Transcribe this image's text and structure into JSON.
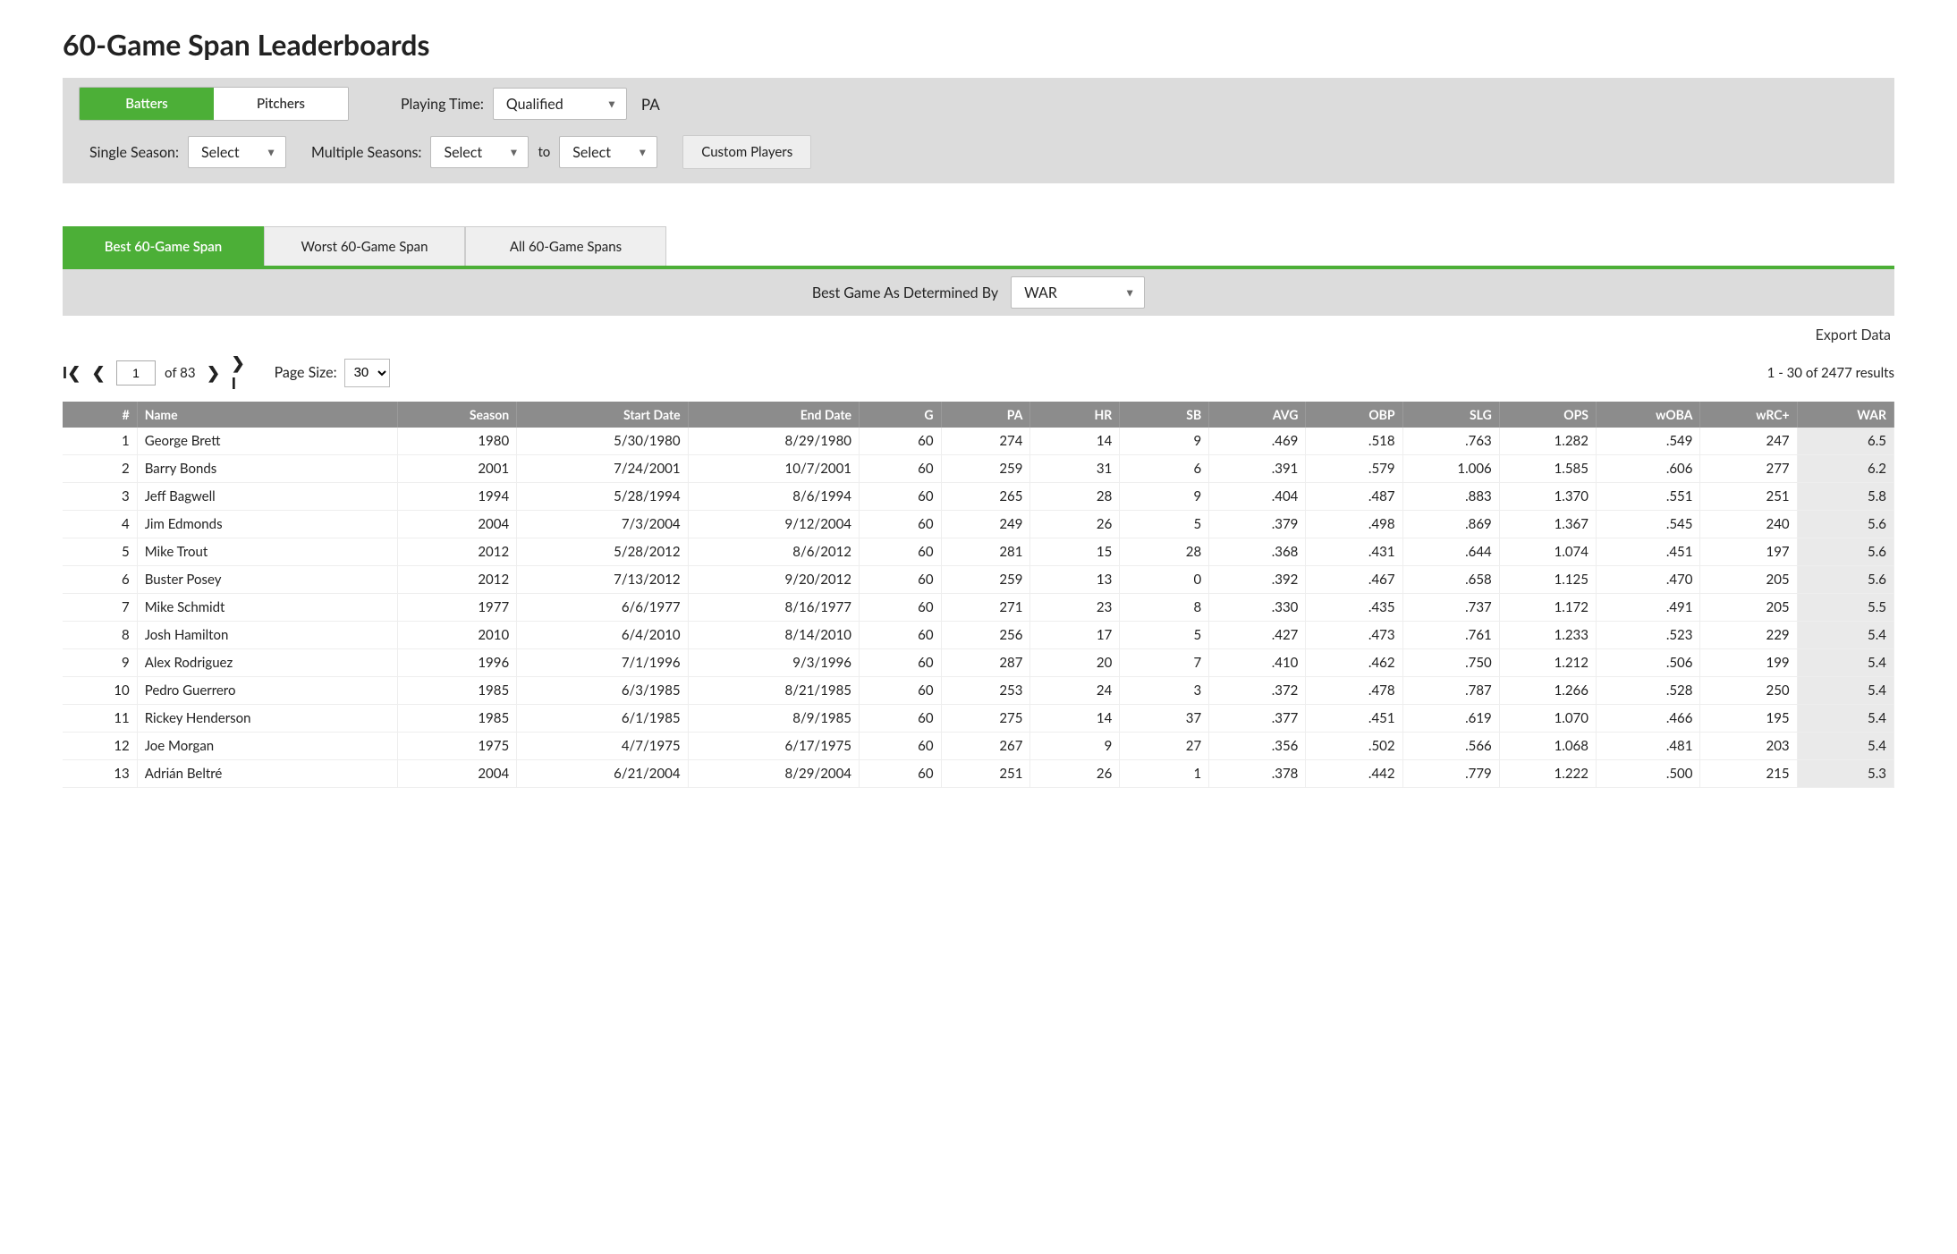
{
  "page_title": "60-Game Span Leaderboards",
  "top_toggle": {
    "batters": "Batters",
    "pitchers": "Pitchers",
    "active": "batters"
  },
  "playing_time": {
    "label": "Playing Time:",
    "value": "Qualified",
    "unit": "PA"
  },
  "single_season": {
    "label": "Single Season:",
    "value": "Select"
  },
  "multi_season": {
    "label": "Multiple Seasons:",
    "from": "Select",
    "to_word": "to",
    "to": "Select"
  },
  "custom_players_btn": "Custom Players",
  "span_tabs": {
    "best": "Best 60-Game Span",
    "worst": "Worst 60-Game Span",
    "all": "All 60-Game Spans",
    "active": "best"
  },
  "determined_by": {
    "label": "Best Game As Determined By",
    "value": "WAR"
  },
  "export_label": "Export Data",
  "pager": {
    "page_value": "1",
    "of_pages": "of 83",
    "page_size_label": "Page Size:",
    "page_size_value": "30",
    "results_text": "1 - 30 of 2477 results"
  },
  "columns": [
    "#",
    "Name",
    "Season",
    "Start Date",
    "End Date",
    "G",
    "PA",
    "HR",
    "SB",
    "AVG",
    "OBP",
    "SLG",
    "OPS",
    "wOBA",
    "wRC+",
    "WAR"
  ],
  "rows": [
    {
      "n": 1,
      "name": "George Brett",
      "season": 1980,
      "start": "5/30/1980",
      "end": "8/29/1980",
      "g": 60,
      "pa": 274,
      "hr": 14,
      "sb": 9,
      "avg": ".469",
      "obp": ".518",
      "slg": ".763",
      "ops": "1.282",
      "woba": ".549",
      "wrc": 247,
      "war": "6.5"
    },
    {
      "n": 2,
      "name": "Barry Bonds",
      "season": 2001,
      "start": "7/24/2001",
      "end": "10/7/2001",
      "g": 60,
      "pa": 259,
      "hr": 31,
      "sb": 6,
      "avg": ".391",
      "obp": ".579",
      "slg": "1.006",
      "ops": "1.585",
      "woba": ".606",
      "wrc": 277,
      "war": "6.2"
    },
    {
      "n": 3,
      "name": "Jeff Bagwell",
      "season": 1994,
      "start": "5/28/1994",
      "end": "8/6/1994",
      "g": 60,
      "pa": 265,
      "hr": 28,
      "sb": 9,
      "avg": ".404",
      "obp": ".487",
      "slg": ".883",
      "ops": "1.370",
      "woba": ".551",
      "wrc": 251,
      "war": "5.8"
    },
    {
      "n": 4,
      "name": "Jim Edmonds",
      "season": 2004,
      "start": "7/3/2004",
      "end": "9/12/2004",
      "g": 60,
      "pa": 249,
      "hr": 26,
      "sb": 5,
      "avg": ".379",
      "obp": ".498",
      "slg": ".869",
      "ops": "1.367",
      "woba": ".545",
      "wrc": 240,
      "war": "5.6"
    },
    {
      "n": 5,
      "name": "Mike Trout",
      "season": 2012,
      "start": "5/28/2012",
      "end": "8/6/2012",
      "g": 60,
      "pa": 281,
      "hr": 15,
      "sb": 28,
      "avg": ".368",
      "obp": ".431",
      "slg": ".644",
      "ops": "1.074",
      "woba": ".451",
      "wrc": 197,
      "war": "5.6"
    },
    {
      "n": 6,
      "name": "Buster Posey",
      "season": 2012,
      "start": "7/13/2012",
      "end": "9/20/2012",
      "g": 60,
      "pa": 259,
      "hr": 13,
      "sb": 0,
      "avg": ".392",
      "obp": ".467",
      "slg": ".658",
      "ops": "1.125",
      "woba": ".470",
      "wrc": 205,
      "war": "5.6"
    },
    {
      "n": 7,
      "name": "Mike Schmidt",
      "season": 1977,
      "start": "6/6/1977",
      "end": "8/16/1977",
      "g": 60,
      "pa": 271,
      "hr": 23,
      "sb": 8,
      "avg": ".330",
      "obp": ".435",
      "slg": ".737",
      "ops": "1.172",
      "woba": ".491",
      "wrc": 205,
      "war": "5.5"
    },
    {
      "n": 8,
      "name": "Josh Hamilton",
      "season": 2010,
      "start": "6/4/2010",
      "end": "8/14/2010",
      "g": 60,
      "pa": 256,
      "hr": 17,
      "sb": 5,
      "avg": ".427",
      "obp": ".473",
      "slg": ".761",
      "ops": "1.233",
      "woba": ".523",
      "wrc": 229,
      "war": "5.4"
    },
    {
      "n": 9,
      "name": "Alex Rodriguez",
      "season": 1996,
      "start": "7/1/1996",
      "end": "9/3/1996",
      "g": 60,
      "pa": 287,
      "hr": 20,
      "sb": 7,
      "avg": ".410",
      "obp": ".462",
      "slg": ".750",
      "ops": "1.212",
      "woba": ".506",
      "wrc": 199,
      "war": "5.4"
    },
    {
      "n": 10,
      "name": "Pedro Guerrero",
      "season": 1985,
      "start": "6/3/1985",
      "end": "8/21/1985",
      "g": 60,
      "pa": 253,
      "hr": 24,
      "sb": 3,
      "avg": ".372",
      "obp": ".478",
      "slg": ".787",
      "ops": "1.266",
      "woba": ".528",
      "wrc": 250,
      "war": "5.4"
    },
    {
      "n": 11,
      "name": "Rickey Henderson",
      "season": 1985,
      "start": "6/1/1985",
      "end": "8/9/1985",
      "g": 60,
      "pa": 275,
      "hr": 14,
      "sb": 37,
      "avg": ".377",
      "obp": ".451",
      "slg": ".619",
      "ops": "1.070",
      "woba": ".466",
      "wrc": 195,
      "war": "5.4"
    },
    {
      "n": 12,
      "name": "Joe Morgan",
      "season": 1975,
      "start": "4/7/1975",
      "end": "6/17/1975",
      "g": 60,
      "pa": 267,
      "hr": 9,
      "sb": 27,
      "avg": ".356",
      "obp": ".502",
      "slg": ".566",
      "ops": "1.068",
      "woba": ".481",
      "wrc": 203,
      "war": "5.4"
    },
    {
      "n": 13,
      "name": "Adrián Beltré",
      "season": 2004,
      "start": "6/21/2004",
      "end": "8/29/2004",
      "g": 60,
      "pa": 251,
      "hr": 26,
      "sb": 1,
      "avg": ".378",
      "obp": ".442",
      "slg": ".779",
      "ops": "1.222",
      "woba": ".500",
      "wrc": 215,
      "war": "5.3"
    }
  ]
}
